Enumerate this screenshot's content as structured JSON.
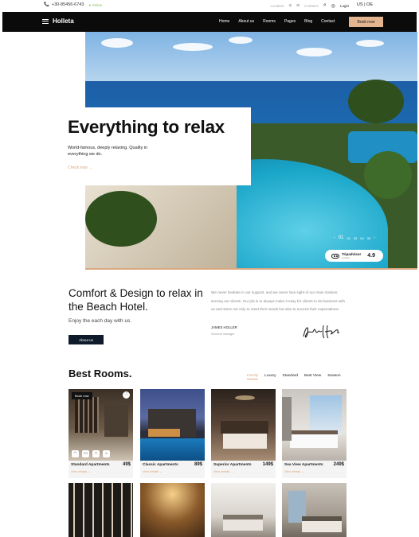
{
  "topbar": {
    "phone": "+30-85456-6743",
    "online": "Online",
    "location": "Location",
    "email": "Contacts",
    "login": "Login",
    "language": "US | OE"
  },
  "nav": {
    "logo": "Holleta",
    "menu": [
      "Home",
      "About us",
      "Rooms",
      "Pages",
      "Blog",
      "Contact"
    ],
    "book": "Book now"
  },
  "hero": {
    "title": "Everything to relax",
    "description": "World-famous, deeply relaxing. Quality in everything we do.",
    "cta": "Check now →",
    "slider": {
      "current": "01",
      "others": [
        "02",
        "03",
        "04",
        "05"
      ]
    },
    "tripadvisor": {
      "name": "Tripadvisor",
      "sub": "reviews",
      "score": "4.9"
    }
  },
  "comfort": {
    "title": "Comfort & Design to relax in the Beach Hotel.",
    "subtitle": "Enjoy the each day with us.",
    "button": "About us",
    "quote": "We never hesitate in our support, and we never lose sight of our main mission: serving our clients. Our job is to always make it easy for clients to do business with us and strive not only to meet their needs but also to exceed their expectations.",
    "author": "JAMES HOLLER",
    "role": "General manager",
    "signature": "James Holler"
  },
  "rooms": {
    "title": "Best Rooms.",
    "filters": [
      "Family",
      "Luxury",
      "Standard",
      "Best View",
      "Season"
    ],
    "active_filter": "Family",
    "cards": [
      {
        "name": "Standard Apartments",
        "price": "49$",
        "details": "View details →",
        "badge": "Book now"
      },
      {
        "name": "Classic Apartments",
        "price": "89$",
        "details": "View details →"
      },
      {
        "name": "Superior Apartments",
        "price": "149$",
        "details": "View details →"
      },
      {
        "name": "Sea View Apartments",
        "price": "249$",
        "details": "View details →"
      }
    ]
  }
}
